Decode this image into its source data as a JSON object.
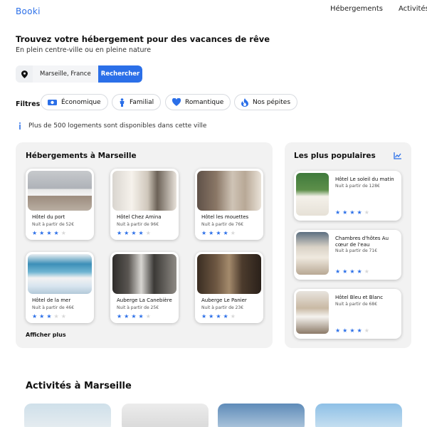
{
  "header": {
    "logo": "Booki",
    "nav": [
      "Hébergements",
      "Activités"
    ]
  },
  "hero": {
    "title": "Trouvez votre hébergement pour des vacances de rêve",
    "subtitle": "En plein centre-ville ou en pleine nature"
  },
  "search": {
    "icon": "location-pin-icon",
    "value": "Marseille, France",
    "button": "Rechercher"
  },
  "filters": {
    "label": "Filtres",
    "items": [
      {
        "label": "Économique",
        "icon": "money-icon"
      },
      {
        "label": "Familial",
        "icon": "person-icon"
      },
      {
        "label": "Romantique",
        "icon": "heart-icon"
      },
      {
        "label": "Nos pépites",
        "icon": "fire-icon"
      }
    ]
  },
  "info": {
    "icon": "info-icon",
    "text": "Plus de 500 logements sont disponibles dans cette ville"
  },
  "accommodations": {
    "title": "Hébergements à Marseille",
    "more": "Afficher plus",
    "cards": [
      {
        "name": "Hôtel du port",
        "price": "Nuit à partir de 52€",
        "rating": 4
      },
      {
        "name": "Hôtel Chez Amina",
        "price": "Nuit à partir de 96€",
        "rating": 4
      },
      {
        "name": "Hôtel les mouettes",
        "price": "Nuit à partir de 76€",
        "rating": 4
      },
      {
        "name": "Hôtel de la mer",
        "price": "Nuit à partir de 46€",
        "rating": 3
      },
      {
        "name": "Auberge La Canebière",
        "price": "Nuit à partir de 25€",
        "rating": 4
      },
      {
        "name": "Auberge Le Panier",
        "price": "Nuit à partir de 23€",
        "rating": 4
      }
    ]
  },
  "popular": {
    "title": "Les plus populaires",
    "icon": "trend-chart-icon",
    "cards": [
      {
        "name": "Hôtel Le soleil du matin",
        "price": "Nuit à partir de 128€",
        "rating": 4
      },
      {
        "name": "Chambres d'hôtes Au cœur de l'eau",
        "price": "Nuit à partir de 71€",
        "rating": 4
      },
      {
        "name": "Hôtel Bleu et Blanc",
        "price": "Nuit à partir de 68€",
        "rating": 4
      }
    ]
  },
  "activities": {
    "title": "Activités à Marseille"
  },
  "colors": {
    "accent": "#2b6fe8",
    "panel": "#f2f2f2"
  }
}
